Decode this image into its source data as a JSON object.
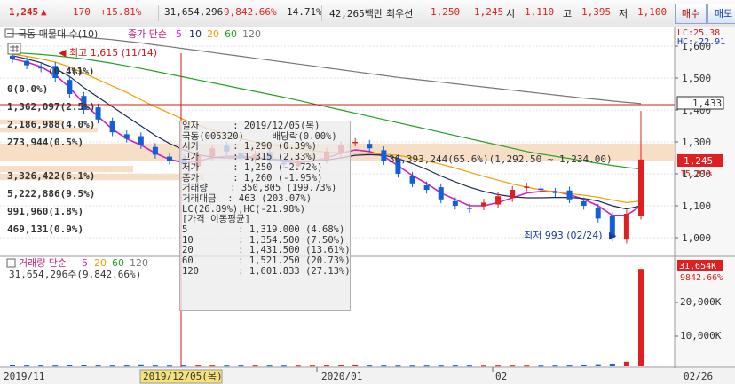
{
  "header": {
    "price": "1,245",
    "up_arrow": "▲",
    "change": "170",
    "change_pct": "+15.81%",
    "volume": "31,654,296",
    "volume_ratio": "9,842.66%",
    "turnover": "14.71%",
    "amount": "42,265백만",
    "pref_label": "최우선",
    "ask": "1,250",
    "bid": "1,245",
    "open_label": "시",
    "open": "1,110",
    "high_label": "고",
    "high": "1,395",
    "low_label": "저",
    "low": "1,100",
    "buy_button": "매수",
    "sell_button": "매도"
  },
  "indicators": {
    "price_title": "국동 매물대 수(10)",
    "ma_label": "종가 단순",
    "ma_periods": [
      "5",
      "10",
      "20",
      "60",
      "120"
    ],
    "volume_title": "거래량 단순",
    "volume_periods": [
      "5",
      "20",
      "60",
      "120"
    ],
    "volume_value": "31,654,296주(9,842.66%)"
  },
  "price_axis": {
    "ticks": [
      "1,600",
      "1,500",
      "1,400",
      "1,300",
      "1,200",
      "1,100",
      "1,000"
    ],
    "lc": "LC:25.38",
    "hc": "HC:-22.91",
    "hline_price": "1,433",
    "current_price": "1,245",
    "current_pct": "15.81%"
  },
  "volume_axis": {
    "ticks": [
      "20,000K",
      "10,000K"
    ],
    "current": "31,654K",
    "current_pct": "9842.66%"
  },
  "volume_profile": [
    {
      "label": "0(0.0%)"
    },
    {
      "label": "1,362,097(2.5%)"
    },
    {
      "label": "2,186,988(4.0%)"
    },
    {
      "label": "273,944(0.5%)"
    },
    {
      "label": "3,326,422(6.1%)"
    },
    {
      "label": "5,222,886(9.5%)"
    },
    {
      "label": "991,960(1.8%)"
    },
    {
      "label": "469,131(0.9%)"
    },
    {
      "label": "(0.4%)"
    },
    {
      "label": "(1%)"
    }
  ],
  "annotations": {
    "high": "최고 1,615 (11/14)",
    "low": "최저 993 (02/24)",
    "profile_peak": "36,393,244(65.6%)(1,292.50 ~ 1,234.00)"
  },
  "x_axis": {
    "labels": [
      "2019/11",
      "2020/01",
      "02",
      "02/26"
    ],
    "cursor_label": "2019/12/05(목)"
  },
  "tooltip": {
    "lines": [
      "일자      : 2019/12/05(목)",
      "국동(005320)     배당락(0.00%)",
      "시가      : 1,290 (0.39%)",
      "고가      : 1,315 (2.33%)",
      "저가      : 1,250 (-2.72%)",
      "종가      : 1,260 (-1.95%)",
      "거래량    : 350,805 (199.73%)",
      "거래대금  : 463 (203.07%)",
      "LC(26.89%),HC(-21.98%)",
      "[가격 이동평균]",
      "5         : 1,319.000 (4.68%)",
      "10        : 1,354.500 (7.50%)",
      "20        : 1,431.500 (13.61%)",
      "60        : 1,521.250 (20.73%)",
      "120       : 1,601.833 (27.13%)"
    ]
  },
  "colors": {
    "up": "#e02020",
    "down": "#1060d8",
    "ma5": "#d020c0",
    "ma10": "#1a2a5a",
    "ma20": "#f0a000",
    "ma60": "#22a022",
    "ma120": "#777777",
    "hline": "#d01818",
    "profile": "#f5dcc0"
  },
  "chart_data": [
    {
      "type": "candlestick",
      "title": "국동 매물대 수(10)",
      "x": [
        "2019/11",
        "2020/01",
        "02",
        "02/26"
      ],
      "ylim": [
        950,
        1650
      ],
      "series": [
        {
          "name": "close",
          "values": [
            1560,
            1540,
            1530,
            1500,
            1450,
            1400,
            1370,
            1330,
            1310,
            1290,
            1260,
            1240,
            1230,
            1260,
            1280,
            1270,
            1250,
            1260,
            1240,
            1230,
            1240,
            1250,
            1270,
            1290,
            1300,
            1280,
            1240,
            1200,
            1170,
            1150,
            1120,
            1100,
            1090,
            1110,
            1130,
            1150,
            1160,
            1150,
            1140,
            1120,
            1100,
            1060,
            1000,
            1075,
            1245
          ]
        },
        {
          "name": "5",
          "values": [
            1560,
            1550,
            1535,
            1510,
            1470,
            1420,
            1380,
            1340,
            1310,
            1290,
            1265,
            1245,
            1235,
            1240,
            1250,
            1255,
            1255,
            1252,
            1245,
            1238,
            1235,
            1240,
            1250,
            1265,
            1275,
            1270,
            1255,
            1225,
            1195,
            1170,
            1140,
            1120,
            1100,
            1100,
            1110,
            1125,
            1140,
            1145,
            1145,
            1135,
            1120,
            1100,
            1070,
            1070,
            1100
          ]
        },
        {
          "name": "10",
          "values": [
            1570,
            1560,
            1548,
            1530,
            1505,
            1470,
            1440,
            1410,
            1380,
            1350,
            1320,
            1295,
            1275,
            1260,
            1252,
            1250,
            1250,
            1250,
            1247,
            1243,
            1240,
            1240,
            1243,
            1250,
            1258,
            1260,
            1258,
            1248,
            1232,
            1214,
            1193,
            1175,
            1158,
            1145,
            1135,
            1128,
            1125,
            1125,
            1126,
            1126,
            1123,
            1115,
            1100,
            1090,
            1100
          ]
        },
        {
          "name": "20",
          "values": [
            1575,
            1568,
            1560,
            1550,
            1535,
            1515,
            1495,
            1475,
            1455,
            1432,
            1410,
            1390,
            1370,
            1352,
            1337,
            1322,
            1310,
            1300,
            1292,
            1285,
            1278,
            1272,
            1268,
            1266,
            1265,
            1264,
            1262,
            1258,
            1250,
            1240,
            1230,
            1218,
            1205,
            1192,
            1180,
            1168,
            1158,
            1150,
            1143,
            1138,
            1133,
            1127,
            1118,
            1110,
            1115
          ]
        },
        {
          "name": "60",
          "values": [
            1580,
            1577,
            1574,
            1570,
            1565,
            1560,
            1553,
            1546,
            1538,
            1530,
            1521,
            1512,
            1503,
            1494,
            1485,
            1476,
            1467,
            1458,
            1449,
            1440,
            1430,
            1420,
            1410,
            1400,
            1390,
            1380,
            1370,
            1360,
            1350,
            1340,
            1330,
            1320,
            1310,
            1300,
            1290,
            1280,
            1270,
            1262,
            1255,
            1248,
            1240,
            1233,
            1226,
            1220,
            1215
          ]
        },
        {
          "name": "120",
          "values": [
            1640,
            1638,
            1636,
            1634,
            1631,
            1628,
            1624,
            1620,
            1615,
            1610,
            1604,
            1598,
            1592,
            1586,
            1580,
            1574,
            1568,
            1562,
            1556,
            1550,
            1544,
            1538,
            1532,
            1526,
            1520,
            1514,
            1508,
            1502,
            1497,
            1492,
            1487,
            1482,
            1477,
            1472,
            1467,
            1462,
            1457,
            1452,
            1447,
            1442,
            1437,
            1433,
            1428,
            1424,
            1420
          ]
        }
      ]
    },
    {
      "type": "bar",
      "title": "거래량 단순",
      "x": [
        "2019/11",
        "2020/01",
        "02",
        "02/26"
      ],
      "ylim": [
        0,
        32000
      ],
      "series": [
        {
          "name": "거래량",
          "values": [
            300,
            250,
            260,
            240,
            280,
            300,
            260,
            240,
            250,
            351,
            240,
            230,
            250,
            260,
            240,
            230,
            250,
            240,
            230,
            220,
            230,
            240,
            260,
            280,
            300,
            250,
            240,
            230,
            220,
            230,
            240,
            250,
            230,
            220,
            230,
            240,
            230,
            220,
            230,
            250,
            300,
            400,
            700,
            1500,
            31654
          ]
        }
      ]
    }
  ]
}
